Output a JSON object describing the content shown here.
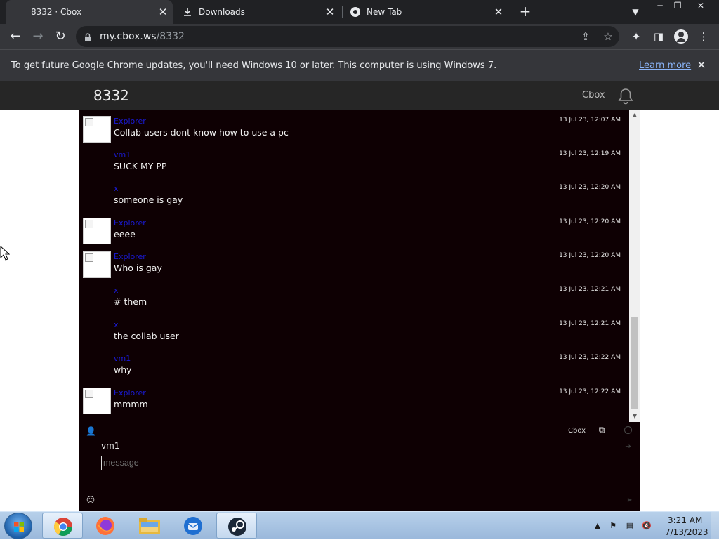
{
  "browser": {
    "tabs": [
      {
        "title": "8332 · Cbox",
        "active": true
      },
      {
        "title": "Downloads",
        "active": false
      },
      {
        "title": "New Tab",
        "active": false
      }
    ],
    "url_host": "my.cbox.ws",
    "url_path": "/8332"
  },
  "infobar": {
    "message": "To get future Google Chrome updates, you'll need Windows 10 or later. This computer is using Windows 7.",
    "learn_more": "Learn more"
  },
  "cbox": {
    "room_title": "8332",
    "brand_link": "Cbox",
    "messages": [
      {
        "nick": "Explorer",
        "text": "Collab users dont know how to use a pc",
        "time": "13 Jul 23, 12:07 AM",
        "avatar": true
      },
      {
        "nick": "vm1",
        "text": "SUCK MY PP",
        "time": "13 Jul 23, 12:19 AM",
        "avatar": false
      },
      {
        "nick": "x",
        "text": "someone is gay",
        "time": "13 Jul 23, 12:20 AM",
        "avatar": false
      },
      {
        "nick": "Explorer",
        "text": "eeee",
        "time": "13 Jul 23, 12:20 AM",
        "avatar": true
      },
      {
        "nick": "Explorer",
        "text": "Who is gay",
        "time": "13 Jul 23, 12:20 AM",
        "avatar": true
      },
      {
        "nick": "x",
        "text": "# them",
        "time": "13 Jul 23, 12:21 AM",
        "avatar": false
      },
      {
        "nick": "x",
        "text": "the collab user",
        "time": "13 Jul 23, 12:21 AM",
        "avatar": false
      },
      {
        "nick": "vm1",
        "text": "why",
        "time": "13 Jul 23, 12:22 AM",
        "avatar": false
      },
      {
        "nick": "Explorer",
        "text": "mmmm",
        "time": "13 Jul 23, 12:22 AM",
        "avatar": true
      }
    ],
    "composer": {
      "brand_small": "Cbox",
      "nick_value": "vm1",
      "message_placeholder": "message"
    }
  },
  "taskbar": {
    "clock_time": "3:21 AM",
    "clock_date": "7/13/2023",
    "apps": [
      "chrome-icon",
      "firefox-icon",
      "file-explorer-icon",
      "thunderbird-icon",
      "steam-icon"
    ]
  }
}
